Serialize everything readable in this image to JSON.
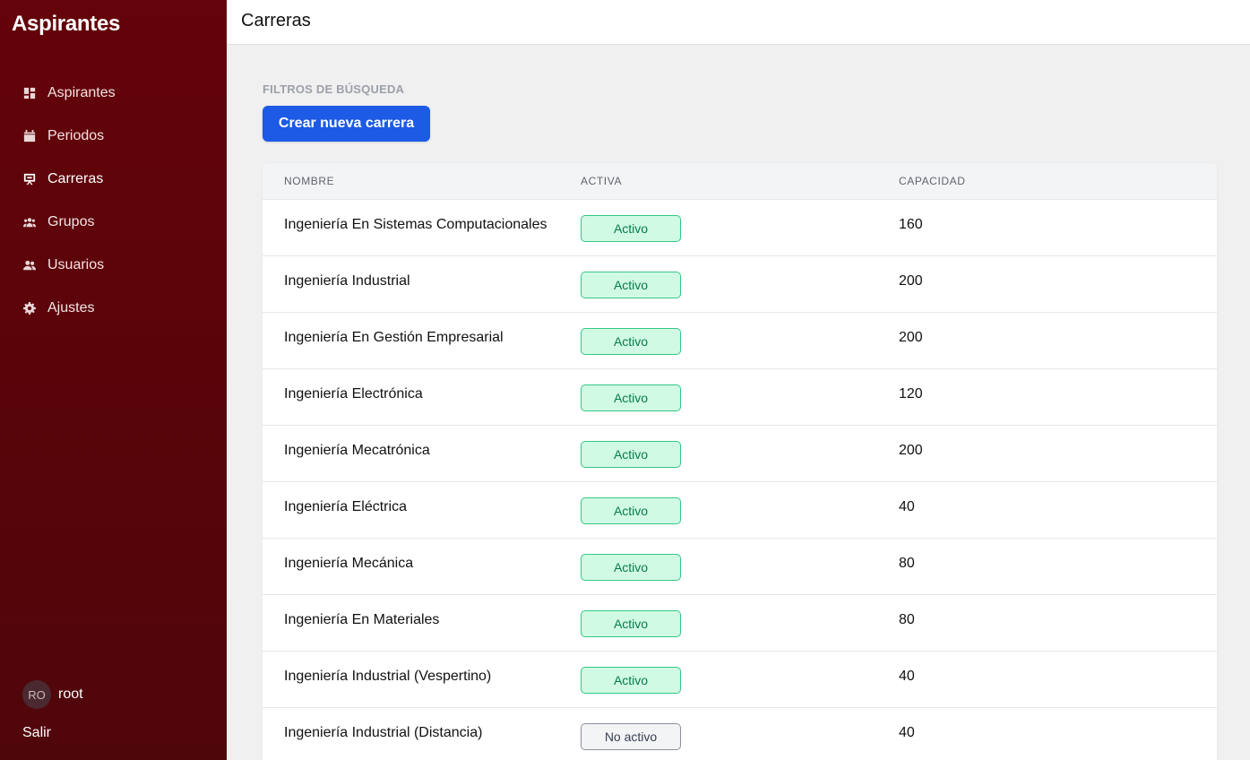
{
  "sidebar": {
    "brand": "Aspirantes",
    "items": [
      {
        "label": "Aspirantes",
        "icon": "dashboard-icon"
      },
      {
        "label": "Periodos",
        "icon": "calendar-icon"
      },
      {
        "label": "Carreras",
        "icon": "presentation-icon"
      },
      {
        "label": "Grupos",
        "icon": "group-icon"
      },
      {
        "label": "Usuarios",
        "icon": "users-icon"
      },
      {
        "label": "Ajustes",
        "icon": "gear-icon"
      }
    ],
    "active_index": 2,
    "user": {
      "initials": "RO",
      "name": "root"
    },
    "logout": "Salir"
  },
  "header": {
    "title": "Carreras"
  },
  "main": {
    "filters_label": "FILTROS DE BÚSQUEDA",
    "create_button": "Crear nueva carrera",
    "table": {
      "headers": {
        "name": "NOMBRE",
        "active": "ACTIVA",
        "capacity": "CAPACIDAD"
      },
      "rows": [
        {
          "name": "Ingeniería En Sistemas Computacionales",
          "status": "Activo",
          "active": true,
          "capacity": "160"
        },
        {
          "name": "Ingeniería Industrial",
          "status": "Activo",
          "active": true,
          "capacity": "200"
        },
        {
          "name": "Ingeniería En Gestión Empresarial",
          "status": "Activo",
          "active": true,
          "capacity": "200"
        },
        {
          "name": "Ingeniería Electrónica",
          "status": "Activo",
          "active": true,
          "capacity": "120"
        },
        {
          "name": "Ingeniería Mecatrónica",
          "status": "Activo",
          "active": true,
          "capacity": "200"
        },
        {
          "name": "Ingeniería Eléctrica",
          "status": "Activo",
          "active": true,
          "capacity": "40"
        },
        {
          "name": "Ingeniería Mecánica",
          "status": "Activo",
          "active": true,
          "capacity": "80"
        },
        {
          "name": "Ingeniería En Materiales",
          "status": "Activo",
          "active": true,
          "capacity": "80"
        },
        {
          "name": "Ingeniería Industrial (Vespertino)",
          "status": "Activo",
          "active": true,
          "capacity": "40"
        },
        {
          "name": "Ingeniería Industrial (Distancia)",
          "status": "No activo",
          "active": false,
          "capacity": "40"
        }
      ]
    }
  },
  "colors": {
    "sidebar_bg": "#5d0409",
    "accent_button": "#1d5ae5",
    "badge_active_bg": "#d1fae5",
    "badge_active_border": "#34c785",
    "badge_inactive_bg": "#f3f4f6"
  }
}
